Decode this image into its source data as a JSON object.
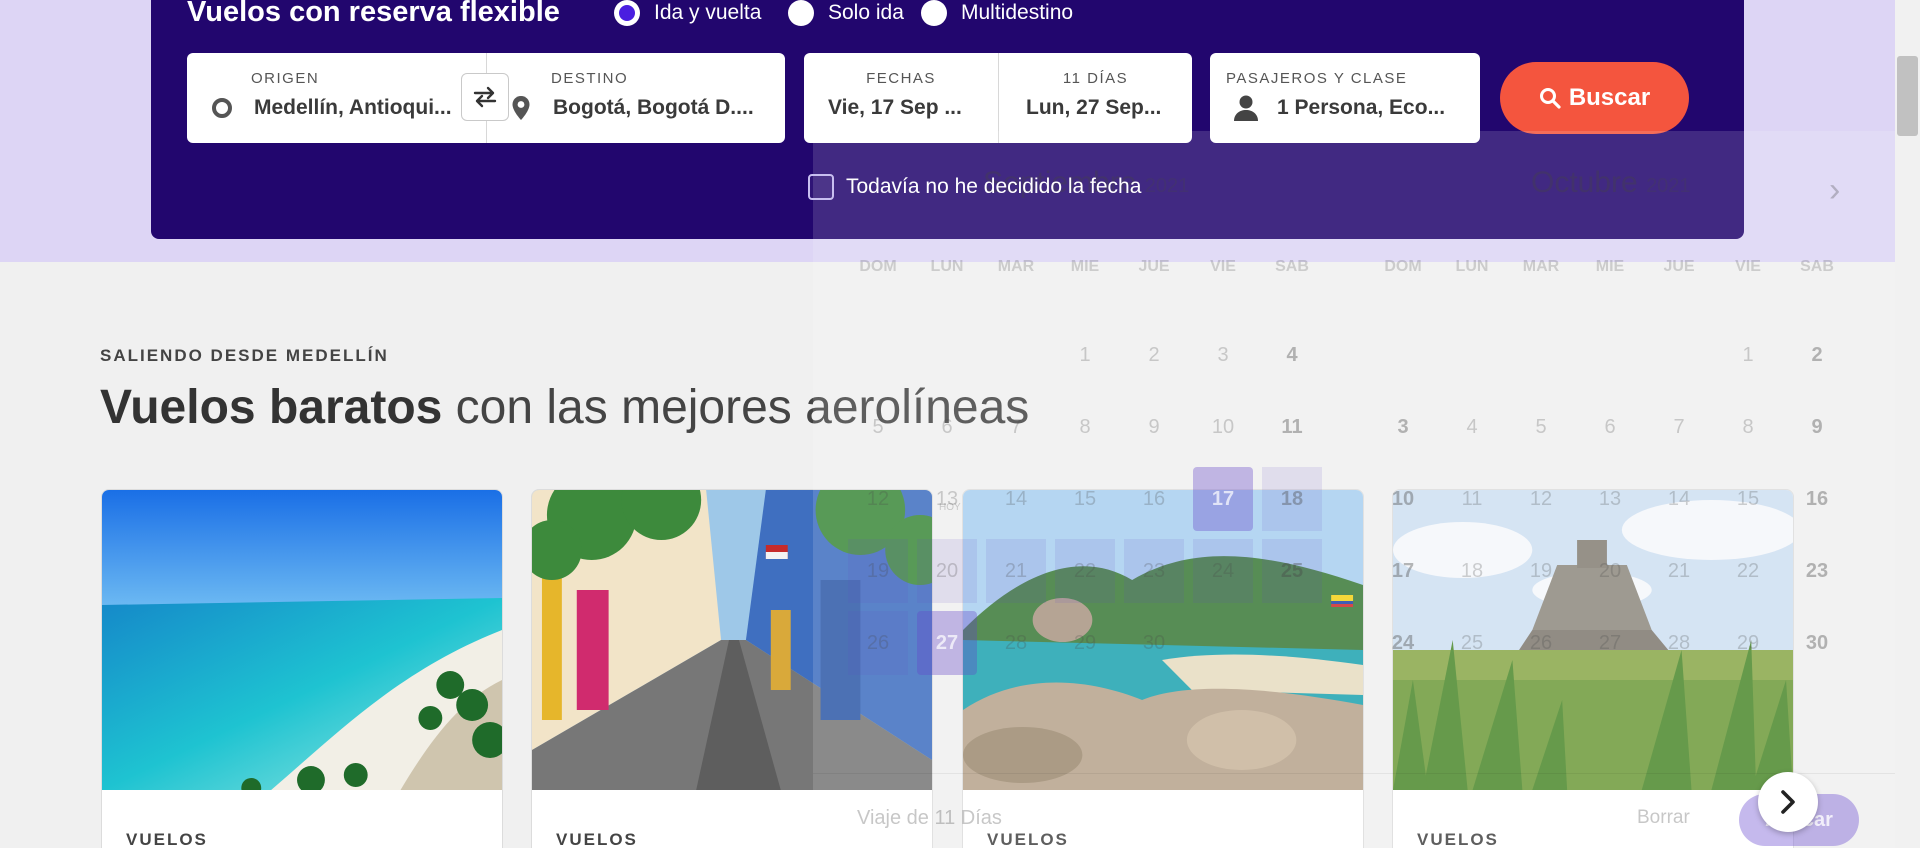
{
  "search": {
    "title": "Vuelos con reserva flexible",
    "trip_types": [
      {
        "label": "Ida y vuelta",
        "selected": true
      },
      {
        "label": "Solo ida",
        "selected": false
      },
      {
        "label": "Multidestino",
        "selected": false
      }
    ],
    "origin": {
      "label": "ORIGEN",
      "value": "Medellín, Antioqui..."
    },
    "destination": {
      "label": "DESTINO",
      "value": "Bogotá, Bogotá D...."
    },
    "dates": {
      "label": "FECHAS",
      "value": "Vie, 17 Sep ..."
    },
    "duration": {
      "label": "11 DÍAS",
      "value": "Lun, 27 Sep..."
    },
    "passengers": {
      "label": "PASAJEROS Y CLASE",
      "value": "1 Persona, Eco..."
    },
    "search_button": "Buscar",
    "undecided_label": "Todavía no he decidido la fecha",
    "accent_color": "#f4553e",
    "panel_color": "#22066e"
  },
  "calendar": {
    "month_left": "Septiembre",
    "month_left_year": "2021",
    "month_right": "Octubre",
    "month_right_year": "2021",
    "weekdays": [
      "DOM",
      "LUN",
      "MAR",
      "MIE",
      "JUE",
      "VIE",
      "SAB"
    ],
    "today_label": "HOY",
    "trip_length": "Viaje de 11 Días",
    "clear_button": "Borrar",
    "apply_button": "Aplicar"
  },
  "section": {
    "kicker": "SALIENDO DESDE MEDELLÍN",
    "title_bold": "Vuelos baratos",
    "title_rest": " con las mejores aerolíneas"
  },
  "cards": [
    {
      "label": "VUELOS",
      "image": "caribbean-beach"
    },
    {
      "label": "VUELOS",
      "image": "colonial-street"
    },
    {
      "label": "VUELOS",
      "image": "rocky-coast"
    },
    {
      "label": "VUELOS",
      "image": "mayan-pyramid"
    }
  ]
}
